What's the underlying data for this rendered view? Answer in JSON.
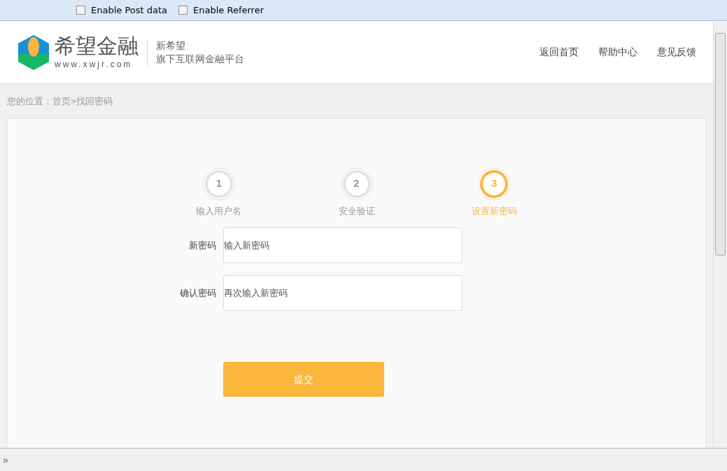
{
  "toolbar": {
    "options": [
      {
        "label": "Enable Post data",
        "checked": false
      },
      {
        "label": "Enable Referrer",
        "checked": false
      }
    ]
  },
  "header": {
    "logo_name": "希望金融",
    "logo_url": "www.xwjr.com",
    "slogan_1": "新希望",
    "slogan_2": "旗下互联网金融平台",
    "nav": [
      "返回首页",
      "帮助中心",
      "意见反馈"
    ]
  },
  "breadcrumb": "您的位置：首页>找回密码",
  "steps": [
    {
      "number": "1",
      "label": "输入用户名",
      "selected": false
    },
    {
      "number": "2",
      "label": "安全验证",
      "selected": false
    },
    {
      "number": "3",
      "label": "设置新密码",
      "selected": true
    }
  ],
  "fields": [
    {
      "label": "新密码",
      "placeholder": "输入新密码"
    },
    {
      "label": "确认密码",
      "placeholder": "再次输入新密码"
    }
  ],
  "submit": "提交",
  "status_bar": {
    "expand": "»"
  }
}
